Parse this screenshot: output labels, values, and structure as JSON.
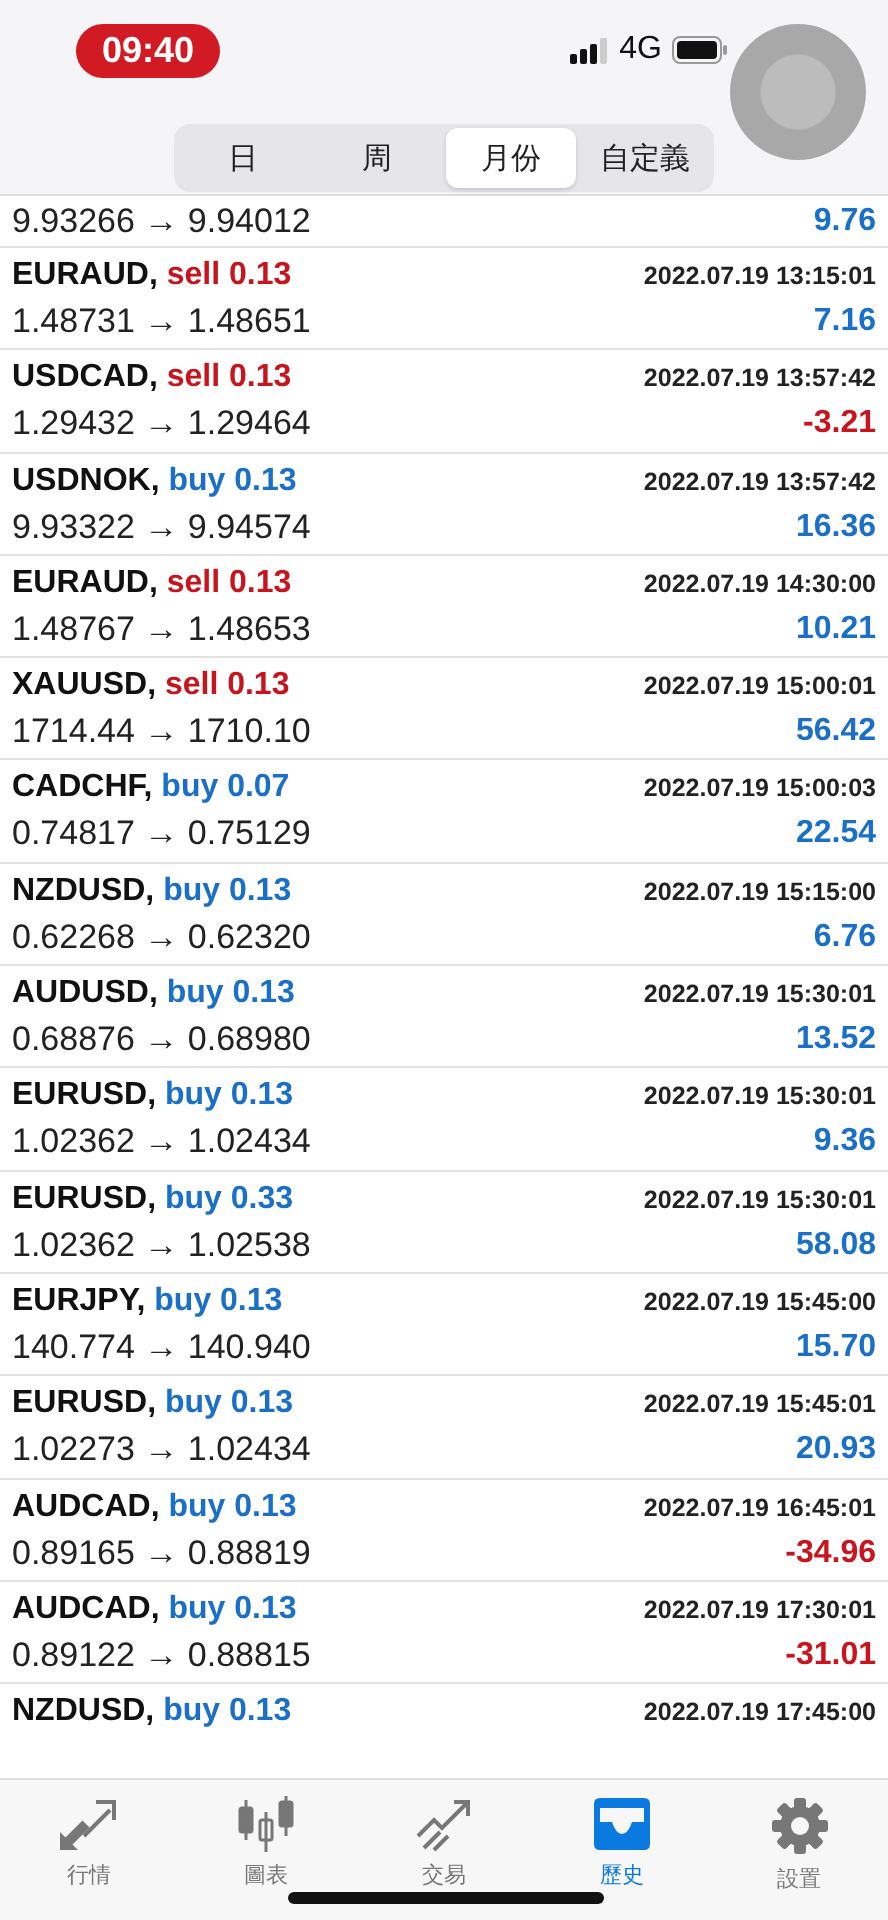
{
  "status_bar": {
    "time": "09:40",
    "network": "4G"
  },
  "period_tabs": [
    {
      "label": "日",
      "selected": false
    },
    {
      "label": "周",
      "selected": false
    },
    {
      "label": "月份",
      "selected": true
    },
    {
      "label": "自定義",
      "selected": false
    }
  ],
  "top_partial_row": {
    "prices": "9.93266 → 9.94012",
    "profit": "9.76",
    "loss": false
  },
  "deals": [
    {
      "symbol": "EURAUD,",
      "kind": "sell",
      "action": "sell 0.13",
      "time": "2022.07.19 13:15:01",
      "prices": "1.48731 → 1.48651",
      "profit": "7.16",
      "loss": false
    },
    {
      "symbol": "USDCAD,",
      "kind": "sell",
      "action": "sell 0.13",
      "time": "2022.07.19 13:57:42",
      "prices": "1.29432 → 1.29464",
      "profit": "-3.21",
      "loss": true
    },
    {
      "symbol": "USDNOK,",
      "kind": "buy",
      "action": "buy 0.13",
      "time": "2022.07.19 13:57:42",
      "prices": "9.93322 → 9.94574",
      "profit": "16.36",
      "loss": false
    },
    {
      "symbol": "EURAUD,",
      "kind": "sell",
      "action": "sell 0.13",
      "time": "2022.07.19 14:30:00",
      "prices": "1.48767 → 1.48653",
      "profit": "10.21",
      "loss": false
    },
    {
      "symbol": "XAUUSD,",
      "kind": "sell",
      "action": "sell 0.13",
      "time": "2022.07.19 15:00:01",
      "prices": "1714.44 → 1710.10",
      "profit": "56.42",
      "loss": false
    },
    {
      "symbol": "CADCHF,",
      "kind": "buy",
      "action": "buy 0.07",
      "time": "2022.07.19 15:00:03",
      "prices": "0.74817 → 0.75129",
      "profit": "22.54",
      "loss": false
    },
    {
      "symbol": "NZDUSD,",
      "kind": "buy",
      "action": "buy 0.13",
      "time": "2022.07.19 15:15:00",
      "prices": "0.62268 → 0.62320",
      "profit": "6.76",
      "loss": false
    },
    {
      "symbol": "AUDUSD,",
      "kind": "buy",
      "action": "buy 0.13",
      "time": "2022.07.19 15:30:01",
      "prices": "0.68876 → 0.68980",
      "profit": "13.52",
      "loss": false
    },
    {
      "symbol": "EURUSD,",
      "kind": "buy",
      "action": "buy 0.13",
      "time": "2022.07.19 15:30:01",
      "prices": "1.02362 → 1.02434",
      "profit": "9.36",
      "loss": false
    },
    {
      "symbol": "EURUSD,",
      "kind": "buy",
      "action": "buy 0.33",
      "time": "2022.07.19 15:30:01",
      "prices": "1.02362 → 1.02538",
      "profit": "58.08",
      "loss": false
    },
    {
      "symbol": "EURJPY,",
      "kind": "buy",
      "action": "buy 0.13",
      "time": "2022.07.19 15:45:00",
      "prices": "140.774 → 140.940",
      "profit": "15.70",
      "loss": false
    },
    {
      "symbol": "EURUSD,",
      "kind": "buy",
      "action": "buy 0.13",
      "time": "2022.07.19 15:45:01",
      "prices": "1.02273 → 1.02434",
      "profit": "20.93",
      "loss": false
    },
    {
      "symbol": "AUDCAD,",
      "kind": "buy",
      "action": "buy 0.13",
      "time": "2022.07.19 16:45:01",
      "prices": "0.89165 → 0.88819",
      "profit": "-34.96",
      "loss": true
    },
    {
      "symbol": "AUDCAD,",
      "kind": "buy",
      "action": "buy 0.13",
      "time": "2022.07.19 17:30:01",
      "prices": "0.89122 → 0.88815",
      "profit": "-31.01",
      "loss": true
    }
  ],
  "bottom_partial_row": {
    "symbol": "NZDUSD,",
    "kind": "buy",
    "action": "buy 0.13",
    "time": "2022.07.19 17:45:00"
  },
  "tab_bar": [
    {
      "kind": "quotes",
      "label": "行情",
      "selected": false
    },
    {
      "kind": "chart",
      "label": "圖表",
      "selected": false
    },
    {
      "kind": "trade",
      "label": "交易",
      "selected": false
    },
    {
      "kind": "history",
      "label": "歷史",
      "selected": true
    },
    {
      "kind": "settings",
      "label": "設置",
      "selected": false
    }
  ]
}
